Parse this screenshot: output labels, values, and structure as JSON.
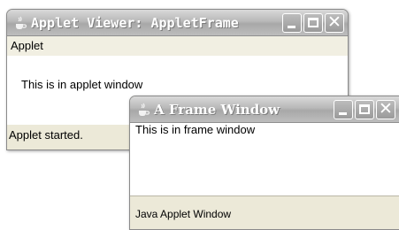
{
  "applet_window": {
    "title": "Applet Viewer: AppletFrame",
    "menu": "Applet",
    "content_text": "This is in applet window",
    "status": "Applet started."
  },
  "frame_window": {
    "title": "A Frame Window",
    "content_text": "This is in frame window",
    "status": "Java Applet Window"
  },
  "icons": {
    "title_icon": "java-cup-icon",
    "minimize": "minimize-icon",
    "maximize": "maximize-icon",
    "close": "close-icon"
  },
  "colors": {
    "title_text": "#ffffff",
    "window_bg": "#ece9d8"
  }
}
